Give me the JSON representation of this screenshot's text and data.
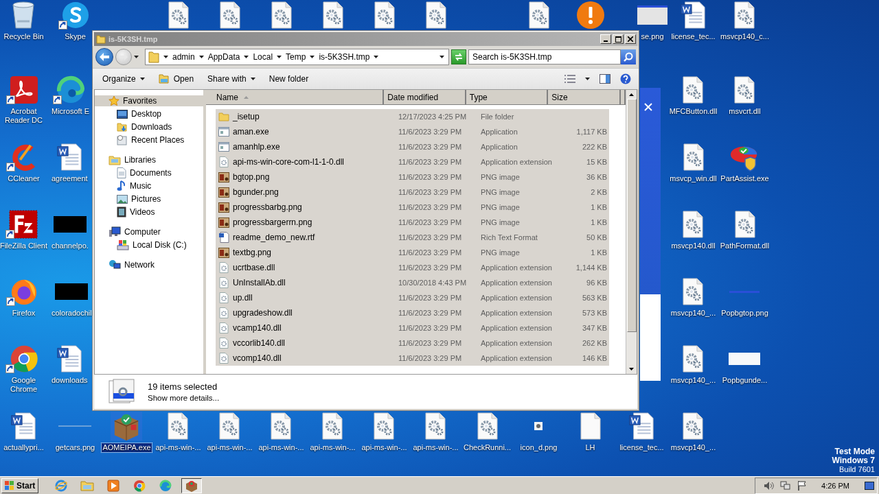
{
  "desktop": {
    "columns": [
      [
        {
          "label": "Recycle Bin",
          "kind": "recycle",
          "shortcut": false,
          "selected": false
        },
        {
          "label": "Acrobat Reader DC",
          "kind": "acrobat",
          "shortcut": true,
          "selected": false
        },
        {
          "label": "CCleaner",
          "kind": "ccleaner",
          "shortcut": true,
          "selected": false
        },
        {
          "label": "FileZilla Client",
          "kind": "filezilla",
          "shortcut": true,
          "selected": false
        },
        {
          "label": "Firefox",
          "kind": "firefox",
          "shortcut": true,
          "selected": false
        },
        {
          "label": "Google Chrome",
          "kind": "chrome",
          "shortcut": true,
          "selected": false
        },
        {
          "label": "actuallypri...",
          "kind": "word",
          "shortcut": false,
          "selected": false
        }
      ],
      [
        {
          "label": "Skype",
          "kind": "skype",
          "shortcut": true,
          "selected": false
        },
        {
          "label": "Microsoft E",
          "kind": "edge",
          "shortcut": true,
          "selected": false,
          "cut_right": true
        },
        {
          "label": "agreement",
          "kind": "word",
          "shortcut": false,
          "selected": false,
          "cut_right": true
        },
        {
          "label": "channelpo.",
          "kind": "black-image",
          "shortcut": false,
          "selected": false,
          "cut_right": true
        },
        {
          "label": "coloradochil",
          "kind": "black-image",
          "shortcut": false,
          "selected": false,
          "cut_right": true
        },
        {
          "label": "downloads",
          "kind": "word",
          "shortcut": false,
          "selected": false,
          "cut_right": true
        },
        {
          "label": "getcars.png",
          "kind": "blank-image",
          "shortcut": false,
          "selected": false
        }
      ],
      [
        null,
        null,
        null,
        null,
        null,
        null,
        {
          "label": "AOMEIPA.exe",
          "kind": "aomei",
          "shortcut": false,
          "selected": true
        }
      ],
      [
        {
          "kind": "dll",
          "shortcut": false,
          "selected": false
        },
        null,
        null,
        null,
        null,
        null,
        {
          "label": "api-ms-win-...",
          "kind": "dll",
          "shortcut": false,
          "selected": false
        }
      ],
      [
        {
          "kind": "dll",
          "shortcut": false,
          "selected": false
        },
        null,
        null,
        null,
        null,
        null,
        {
          "label": "api-ms-win-...",
          "kind": "dll",
          "shortcut": false,
          "selected": false
        }
      ],
      [
        {
          "kind": "dll",
          "shortcut": false,
          "selected": false
        },
        null,
        null,
        null,
        null,
        null,
        {
          "label": "api-ms-win-...",
          "kind": "dll",
          "shortcut": false,
          "selected": false
        }
      ],
      [
        {
          "kind": "dll",
          "shortcut": false,
          "selected": false
        },
        null,
        null,
        null,
        null,
        null,
        {
          "label": "api-ms-win-...",
          "kind": "dll",
          "shortcut": false,
          "selected": false
        }
      ],
      [
        {
          "kind": "dll",
          "shortcut": false,
          "selected": false
        },
        null,
        null,
        null,
        null,
        null,
        {
          "label": "api-ms-win-...",
          "kind": "dll",
          "shortcut": false,
          "selected": false
        }
      ],
      [
        {
          "kind": "dll",
          "shortcut": false,
          "selected": false
        },
        null,
        null,
        null,
        null,
        null,
        {
          "label": "api-ms-win-...",
          "kind": "dll",
          "shortcut": false,
          "selected": false
        }
      ],
      [
        null,
        null,
        null,
        null,
        null,
        null,
        {
          "label": "CheckRunni...",
          "kind": "dll",
          "shortcut": false,
          "selected": false
        }
      ],
      [
        {
          "kind": "dll",
          "shortcut": false,
          "selected": false
        },
        null,
        null,
        null,
        null,
        null,
        {
          "label": "icon_d.png",
          "kind": "dot-image",
          "shortcut": false,
          "selected": false
        }
      ],
      [
        {
          "kind": "alert",
          "shortcut": false,
          "selected": false
        },
        null,
        null,
        null,
        null,
        null,
        {
          "label": "LH",
          "kind": "blank-file",
          "shortcut": false,
          "selected": false
        }
      ],
      [
        {
          "label": "se.png",
          "kind": "gray-image",
          "shortcut": false,
          "selected": false,
          "cut_left": true
        },
        null,
        null,
        null,
        null,
        null,
        {
          "label": "license_tec...",
          "kind": "word",
          "shortcut": false,
          "selected": false
        }
      ],
      [
        {
          "label": "license_tec...",
          "kind": "word",
          "shortcut": false,
          "selected": false
        },
        {
          "label": "MFCButton.dll",
          "kind": "dll",
          "shortcut": false,
          "selected": false
        },
        {
          "label": "msvcp_win.dll",
          "kind": "dll",
          "shortcut": false,
          "selected": false
        },
        {
          "label": "msvcp140.dll",
          "kind": "dll",
          "shortcut": false,
          "selected": false
        },
        {
          "label": "msvcp140_...",
          "kind": "dll",
          "shortcut": false,
          "selected": false
        },
        {
          "label": "msvcp140_...",
          "kind": "dll",
          "shortcut": false,
          "selected": false
        },
        {
          "label": "msvcp140_...",
          "kind": "dll",
          "shortcut": false,
          "selected": false
        }
      ],
      [
        {
          "label": "msvcp140_c...",
          "kind": "dll",
          "shortcut": false,
          "selected": false
        },
        {
          "label": "msvcrt.dll",
          "kind": "dll",
          "shortcut": false,
          "selected": false
        },
        {
          "label": "PartAssist.exe",
          "kind": "partassist",
          "shortcut": false,
          "selected": false
        },
        {
          "label": "PathFormat.dll",
          "kind": "dll",
          "shortcut": false,
          "selected": false
        },
        {
          "label": "Popbgtop.png",
          "kind": "line-image",
          "shortcut": false,
          "selected": false
        },
        {
          "label": "Popbgunde...",
          "kind": "white-image",
          "shortcut": false,
          "selected": false
        },
        null
      ]
    ],
    "edition": [
      "Test Mode",
      "Windows 7",
      "Build 7601"
    ]
  },
  "window": {
    "title": "is-5K3SH.tmp",
    "breadcrumbs": [
      "admin",
      "AppData",
      "Local",
      "Temp",
      "is-5K3SH.tmp"
    ],
    "search": {
      "placeholder": "Search is-5K3SH.tmp"
    },
    "toolbar": [
      {
        "label": "Organize",
        "kind": "menu"
      },
      {
        "label": "Open",
        "kind": "open"
      },
      {
        "label": "Share with",
        "kind": "menu"
      },
      {
        "label": "New folder",
        "kind": "plain"
      }
    ],
    "nav": [
      {
        "label": "Favorites",
        "kind": "favorites",
        "selected": true,
        "children": [
          {
            "label": "Desktop",
            "kind": "desktop",
            "selected": false
          },
          {
            "label": "Downloads",
            "kind": "downloads",
            "selected": false
          },
          {
            "label": "Recent Places",
            "kind": "recent",
            "selected": false
          }
        ]
      },
      {
        "label": "Libraries",
        "kind": "libraries",
        "selected": false,
        "children": [
          {
            "label": "Documents",
            "kind": "documents",
            "selected": false
          },
          {
            "label": "Music",
            "kind": "music",
            "selected": false
          },
          {
            "label": "Pictures",
            "kind": "pictures",
            "selected": false
          },
          {
            "label": "Videos",
            "kind": "videos",
            "selected": false
          }
        ]
      },
      {
        "label": "Computer",
        "kind": "computer",
        "selected": false,
        "children": [
          {
            "label": "Local Disk (C:)",
            "kind": "disk",
            "selected": false
          }
        ]
      },
      {
        "label": "Network",
        "kind": "network",
        "selected": false
      }
    ],
    "columns": [
      "Name",
      "Date modified",
      "Type",
      "Size"
    ],
    "files": [
      {
        "name": "_isetup",
        "kind": "folder",
        "date": "12/17/2023 4:25 PM",
        "type": "File folder",
        "selected": true
      },
      {
        "name": "aman.exe",
        "kind": "exe",
        "date": "11/6/2023 3:29 PM",
        "type": "Application",
        "size": "1,117 KB",
        "selected": true
      },
      {
        "name": "amanhlp.exe",
        "kind": "exe",
        "date": "11/6/2023 3:29 PM",
        "type": "Application",
        "size": "222 KB",
        "selected": true
      },
      {
        "name": "api-ms-win-core-com-l1-1-0.dll",
        "kind": "dll",
        "date": "11/6/2023 3:29 PM",
        "type": "Application extension",
        "size": "15 KB",
        "selected": true
      },
      {
        "name": "bgtop.png",
        "kind": "png",
        "date": "11/6/2023 3:29 PM",
        "type": "PNG image",
        "size": "36 KB",
        "selected": true
      },
      {
        "name": "bgunder.png",
        "kind": "png",
        "date": "11/6/2023 3:29 PM",
        "type": "PNG image",
        "size": "2 KB",
        "selected": true
      },
      {
        "name": "progressbarbg.png",
        "kind": "png",
        "date": "11/6/2023 3:29 PM",
        "type": "PNG image",
        "size": "1 KB",
        "selected": true
      },
      {
        "name": "progressbargerrn.png",
        "kind": "png",
        "date": "11/6/2023 3:29 PM",
        "type": "PNG image",
        "size": "1 KB",
        "selected": true
      },
      {
        "name": "readme_demo_new.rtf",
        "kind": "rtf",
        "date": "11/6/2023 3:29 PM",
        "type": "Rich Text Format",
        "size": "50 KB",
        "selected": true
      },
      {
        "name": "textbg.png",
        "kind": "png",
        "date": "11/6/2023 3:29 PM",
        "type": "PNG image",
        "size": "1 KB",
        "selected": true
      },
      {
        "name": "ucrtbase.dll",
        "kind": "dll",
        "date": "11/6/2023 3:29 PM",
        "type": "Application extension",
        "size": "1,144 KB",
        "selected": true
      },
      {
        "name": "UnInstallAb.dll",
        "kind": "dll",
        "date": "10/30/2018 4:43 PM",
        "type": "Application extension",
        "size": "96 KB",
        "selected": true
      },
      {
        "name": "up.dll",
        "kind": "dll",
        "date": "11/6/2023 3:29 PM",
        "type": "Application extension",
        "size": "563 KB",
        "selected": true
      },
      {
        "name": "upgradeshow.dll",
        "kind": "dll",
        "date": "11/6/2023 3:29 PM",
        "type": "Application extension",
        "size": "573 KB",
        "selected": true
      },
      {
        "name": "vcamp140.dll",
        "kind": "dll",
        "date": "11/6/2023 3:29 PM",
        "type": "Application extension",
        "size": "347 KB",
        "selected": true
      },
      {
        "name": "vccorlib140.dll",
        "kind": "dll",
        "date": "11/6/2023 3:29 PM",
        "type": "Application extension",
        "size": "262 KB",
        "selected": true
      },
      {
        "name": "vcomp140.dll",
        "kind": "dll",
        "date": "11/6/2023 3:29 PM",
        "type": "Application extension",
        "size": "146 KB",
        "selected": true
      }
    ],
    "details": {
      "count": "19 items selected",
      "link": "Show more details..."
    }
  },
  "taskbar": {
    "start": "Start",
    "apps": [
      {
        "kind": "ie",
        "active": false
      },
      {
        "kind": "folder",
        "active": false
      },
      {
        "kind": "media",
        "active": false
      },
      {
        "kind": "chrome",
        "active": false
      },
      {
        "kind": "edge",
        "active": false
      },
      {
        "kind": "aomei",
        "active": true
      }
    ],
    "clock": "4:26 PM"
  }
}
